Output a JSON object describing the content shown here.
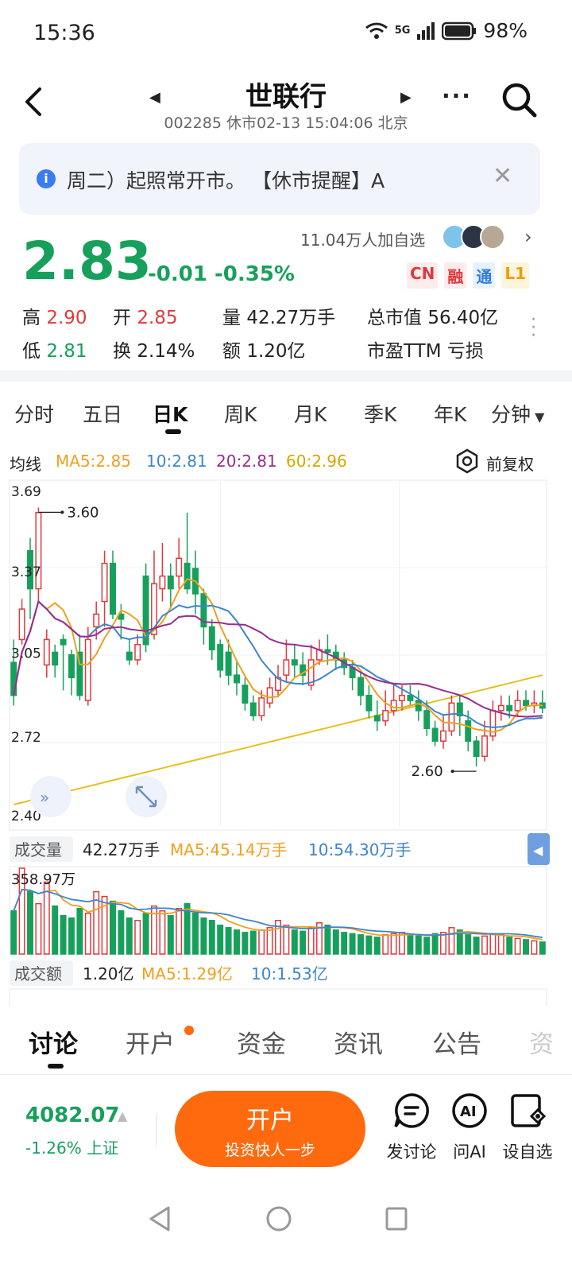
{
  "status_bar": {
    "time": "15:36",
    "network": "5G",
    "battery": "98%"
  },
  "header": {
    "title": "世联行",
    "subtitle": "002285 休市02-13 15:04:06 北京"
  },
  "notice": {
    "text": "周二）起照常开市。    【休市提醒】A"
  },
  "quote": {
    "price": "2.83",
    "change": "-0.01 -0.35%",
    "watchers": "11.04万人加自选",
    "badges": [
      "CN",
      "融",
      "通",
      "L1"
    ],
    "high_label": "高",
    "high": "2.90",
    "low_label": "低",
    "low": "2.81",
    "open_label": "开",
    "open": "2.85",
    "turnover_label": "换",
    "turnover": "2.14%",
    "volume_label": "量",
    "volume": "42.27万手",
    "amount_label": "额",
    "amount": "1.20亿",
    "mktcap_label": "总市值",
    "mktcap": "56.40亿",
    "pe_label": "市盈TTM",
    "pe": "亏损"
  },
  "ktabs": [
    "分时",
    "五日",
    "日K",
    "周K",
    "月K",
    "季K",
    "年K",
    "分钟"
  ],
  "ktab_active": "日K",
  "ma_legend": {
    "label": "均线",
    "ma5": "MA5:2.85",
    "ma10": "10:2.81",
    "ma20": "20:2.81",
    "ma60": "60:2.96",
    "adjust": "前复权"
  },
  "volume_legend": {
    "label": "成交量",
    "value": "42.27万手",
    "ma5": "MA5:45.14万手",
    "ma10": "10:54.30万手",
    "max": "358.97万"
  },
  "amount_legend": {
    "label": "成交额",
    "value": "1.20亿",
    "ma5": "MA5:1.29亿",
    "ma10": "10:1.53亿"
  },
  "bottom_tabs": [
    "讨论",
    "开户",
    "资金",
    "资讯",
    "公告",
    "资"
  ],
  "footer": {
    "index_value": "4082.07",
    "index_change": "-1.26% 上证",
    "open_btn": "开户",
    "open_btn_sub": "投资快人一步",
    "actions": [
      "发讨论",
      "问AI",
      "设自选"
    ]
  },
  "colors": {
    "up": "#e0393e",
    "down": "#17a05c",
    "ma5": "#f0a020",
    "ma10": "#3d86c8",
    "ma20": "#9b2c8e",
    "ma60": "#e6c020",
    "accent": "#ff6a0e"
  },
  "chart_data": {
    "type": "candlestick",
    "y_ticks": [
      "3.69",
      "3.37",
      "3.05",
      "2.72",
      "2.40"
    ],
    "ylim": [
      2.4,
      3.69
    ],
    "high_annotation": "3.60",
    "low_annotation": "2.60",
    "candles": [
      [
        3.01,
        2.88,
        3.1,
        2.84
      ],
      [
        3.1,
        3.22,
        3.26,
        3.08
      ],
      [
        3.45,
        3.3,
        3.5,
        3.18
      ],
      [
        3.3,
        3.6,
        3.62,
        3.25
      ],
      [
        3.0,
        3.1,
        3.14,
        2.95
      ],
      [
        3.05,
        3.0,
        3.08,
        2.95
      ],
      [
        3.1,
        3.08,
        3.12,
        2.9
      ],
      [
        3.04,
        2.95,
        3.06,
        2.88
      ],
      [
        3.05,
        2.88,
        3.12,
        2.86
      ],
      [
        2.86,
        3.1,
        3.15,
        2.84
      ],
      [
        3.15,
        3.2,
        3.25,
        3.1
      ],
      [
        3.25,
        3.4,
        3.45,
        3.15
      ],
      [
        3.4,
        3.2,
        3.45,
        3.18
      ],
      [
        3.2,
        3.18,
        3.24,
        3.1
      ],
      [
        3.05,
        3.02,
        3.1,
        3.0
      ],
      [
        3.02,
        3.08,
        3.12,
        3.0
      ],
      [
        3.35,
        3.08,
        3.4,
        3.05
      ],
      [
        3.12,
        3.32,
        3.45,
        3.1
      ],
      [
        3.3,
        3.35,
        3.48,
        3.25
      ],
      [
        3.35,
        3.3,
        3.4,
        3.22
      ],
      [
        3.35,
        3.42,
        3.5,
        3.3
      ],
      [
        3.4,
        3.3,
        3.6,
        3.28
      ],
      [
        3.38,
        3.28,
        3.45,
        3.2
      ],
      [
        3.28,
        3.15,
        3.3,
        3.08
      ],
      [
        3.15,
        3.06,
        3.18,
        3.02
      ],
      [
        3.08,
        2.98,
        3.1,
        2.95
      ],
      [
        3.05,
        2.96,
        3.1,
        2.92
      ],
      [
        2.96,
        2.93,
        3.02,
        2.88
      ],
      [
        2.92,
        2.85,
        2.95,
        2.82
      ],
      [
        2.85,
        2.8,
        2.88,
        2.78
      ],
      [
        2.8,
        2.87,
        2.9,
        2.78
      ],
      [
        2.85,
        2.91,
        2.95,
        2.83
      ],
      [
        2.9,
        2.95,
        3.0,
        2.88
      ],
      [
        2.96,
        3.02,
        3.1,
        2.93
      ],
      [
        3.02,
        3.0,
        3.08,
        2.95
      ],
      [
        3.0,
        2.96,
        3.05,
        2.92
      ],
      [
        2.92,
        3.02,
        3.08,
        2.9
      ],
      [
        3.02,
        3.06,
        3.1,
        3.0
      ],
      [
        3.06,
        3.05,
        3.12,
        3.0
      ],
      [
        3.05,
        3.02,
        3.08,
        2.98
      ],
      [
        3.02,
        2.99,
        3.05,
        2.96
      ],
      [
        2.99,
        2.95,
        3.02,
        2.9
      ],
      [
        2.95,
        2.88,
        2.98,
        2.84
      ],
      [
        2.88,
        2.82,
        2.92,
        2.79
      ],
      [
        2.8,
        2.78,
        2.86,
        2.74
      ],
      [
        2.78,
        2.82,
        2.9,
        2.76
      ],
      [
        2.82,
        2.86,
        2.92,
        2.8
      ],
      [
        2.86,
        2.88,
        2.92,
        2.82
      ],
      [
        2.88,
        2.86,
        2.92,
        2.84
      ],
      [
        2.86,
        2.82,
        2.9,
        2.78
      ],
      [
        2.82,
        2.75,
        2.86,
        2.72
      ],
      [
        2.75,
        2.7,
        2.78,
        2.68
      ],
      [
        2.7,
        2.74,
        2.8,
        2.67
      ],
      [
        2.74,
        2.85,
        2.88,
        2.72
      ],
      [
        2.85,
        2.8,
        2.88,
        2.72
      ],
      [
        2.78,
        2.7,
        2.82,
        2.66
      ],
      [
        2.7,
        2.64,
        2.72,
        2.6
      ],
      [
        2.64,
        2.72,
        2.78,
        2.62
      ],
      [
        2.72,
        2.82,
        2.86,
        2.7
      ],
      [
        2.82,
        2.84,
        2.88,
        2.78
      ],
      [
        2.84,
        2.82,
        2.88,
        2.79
      ],
      [
        2.82,
        2.86,
        2.9,
        2.8
      ],
      [
        2.86,
        2.84,
        2.9,
        2.82
      ],
      [
        2.84,
        2.85,
        2.9,
        2.81
      ],
      [
        2.85,
        2.83,
        2.9,
        2.81
      ]
    ],
    "volumes": [
      180,
      358,
      260,
      210,
      300,
      200,
      160,
      150,
      190,
      170,
      260,
      240,
      220,
      180,
      150,
      140,
      170,
      200,
      180,
      160,
      190,
      210,
      170,
      150,
      140,
      120,
      110,
      100,
      90,
      95,
      100,
      110,
      140,
      120,
      100,
      95,
      110,
      130,
      120,
      100,
      90,
      85,
      80,
      75,
      70,
      80,
      85,
      90,
      80,
      75,
      70,
      85,
      90,
      110,
      100,
      80,
      70,
      75,
      85,
      80,
      70,
      65,
      60,
      55,
      50
    ]
  }
}
